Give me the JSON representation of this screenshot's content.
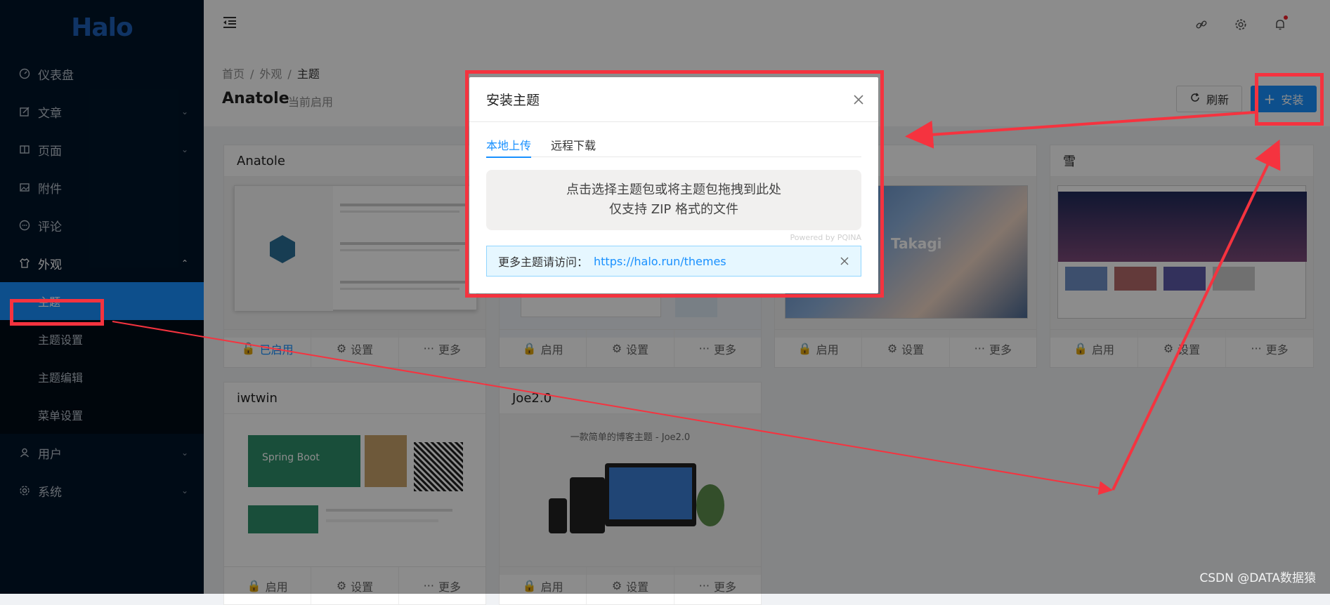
{
  "app": {
    "logo_text": "Halo"
  },
  "sidebar": {
    "items": [
      {
        "label": "仪表盘",
        "icon": "dashboard-icon"
      },
      {
        "label": "文章",
        "icon": "edit-icon",
        "expandable": true
      },
      {
        "label": "页面",
        "icon": "book-icon",
        "expandable": true
      },
      {
        "label": "附件",
        "icon": "picture-icon"
      },
      {
        "label": "评论",
        "icon": "comment-icon"
      },
      {
        "label": "外观",
        "icon": "skin-icon",
        "expanded": true
      },
      {
        "label": "用户",
        "icon": "user-icon",
        "expandable": true
      },
      {
        "label": "系统",
        "icon": "setting-icon",
        "expandable": true
      }
    ],
    "appearance_sub": [
      "主题",
      "主题设置",
      "主题编辑",
      "菜单设置"
    ]
  },
  "header": {
    "breadcrumb": [
      "首页",
      "外观",
      "主题"
    ],
    "title": "Anatole",
    "subtitle": "当前启用",
    "refresh_label": "刷新",
    "install_label": "安装"
  },
  "cards": [
    {
      "title": "Anatole",
      "actions": [
        "已启用",
        "设置",
        "更多"
      ],
      "enabled": true
    },
    {
      "title": "",
      "actions": [
        "启用",
        "设置",
        "更多"
      ]
    },
    {
      "title": "",
      "actions": [
        "启用",
        "设置",
        "更多"
      ],
      "cover_text": "Takagi"
    },
    {
      "title": "雪",
      "actions": [
        "启用",
        "设置",
        "更多"
      ]
    },
    {
      "title": "iwtwin",
      "actions": [
        "启用",
        "设置",
        "更多"
      ],
      "cover_text": "Spring Boot"
    },
    {
      "title": "Joe2.0",
      "actions": [
        "启用",
        "设置",
        "更多"
      ],
      "cover_text": "一款简单的博客主题 - Joe2.0"
    }
  ],
  "modal": {
    "title": "安装主题",
    "tabs": [
      "本地上传",
      "远程下载"
    ],
    "dropzone_line1": "点击选择主题包或将主题包拖拽到此处",
    "dropzone_line2": "仅支持 ZIP 格式的文件",
    "powered": "Powered by PQINA",
    "alert_label": "更多主题请访问：",
    "alert_link": "https://halo.run/themes"
  },
  "watermark": "CSDN @DATA数据猿",
  "colors": {
    "primary": "#1890ff",
    "sidebar": "#001529",
    "annotation": "#f5333f"
  }
}
